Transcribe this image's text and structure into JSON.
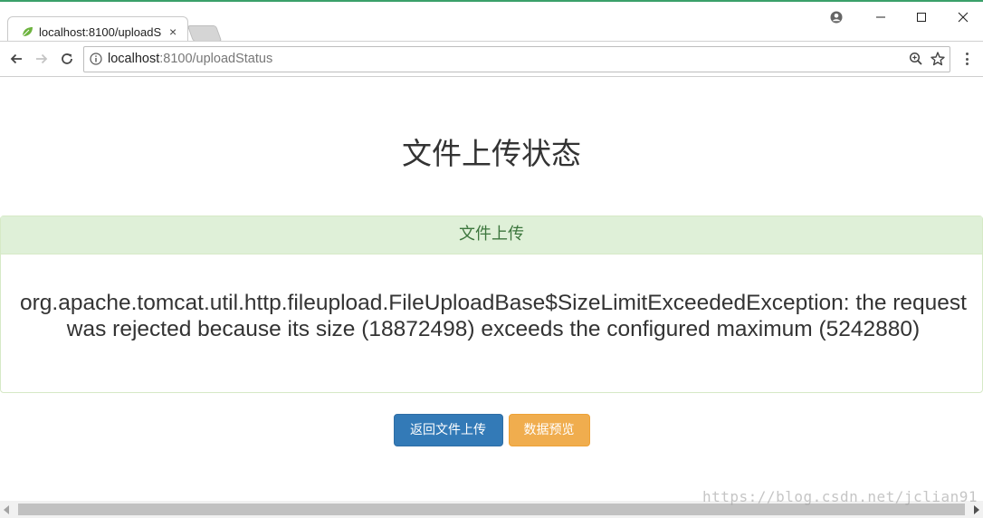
{
  "browser": {
    "tab_title": "localhost:8100/uploadS",
    "tab_close": "×",
    "url_host": "localhost",
    "url_rest": ":8100/uploadStatus",
    "accent_color": "#3aa06a"
  },
  "page": {
    "heading": "文件上传状态",
    "panel_title": "文件上传",
    "message": "org.apache.tomcat.util.http.fileupload.FileUploadBase$SizeLimitExceededException: the request was rejected because its size (18872498) exceeds the configured maximum (5242880)",
    "back_button": "返回文件上传",
    "preview_button": "数据预览"
  },
  "colors": {
    "primary": "#337ab7",
    "warning": "#f0ad4e",
    "success_bg": "#dff0d8",
    "success_text": "#3c763d"
  },
  "watermark": "https://blog.csdn.net/jclian91"
}
